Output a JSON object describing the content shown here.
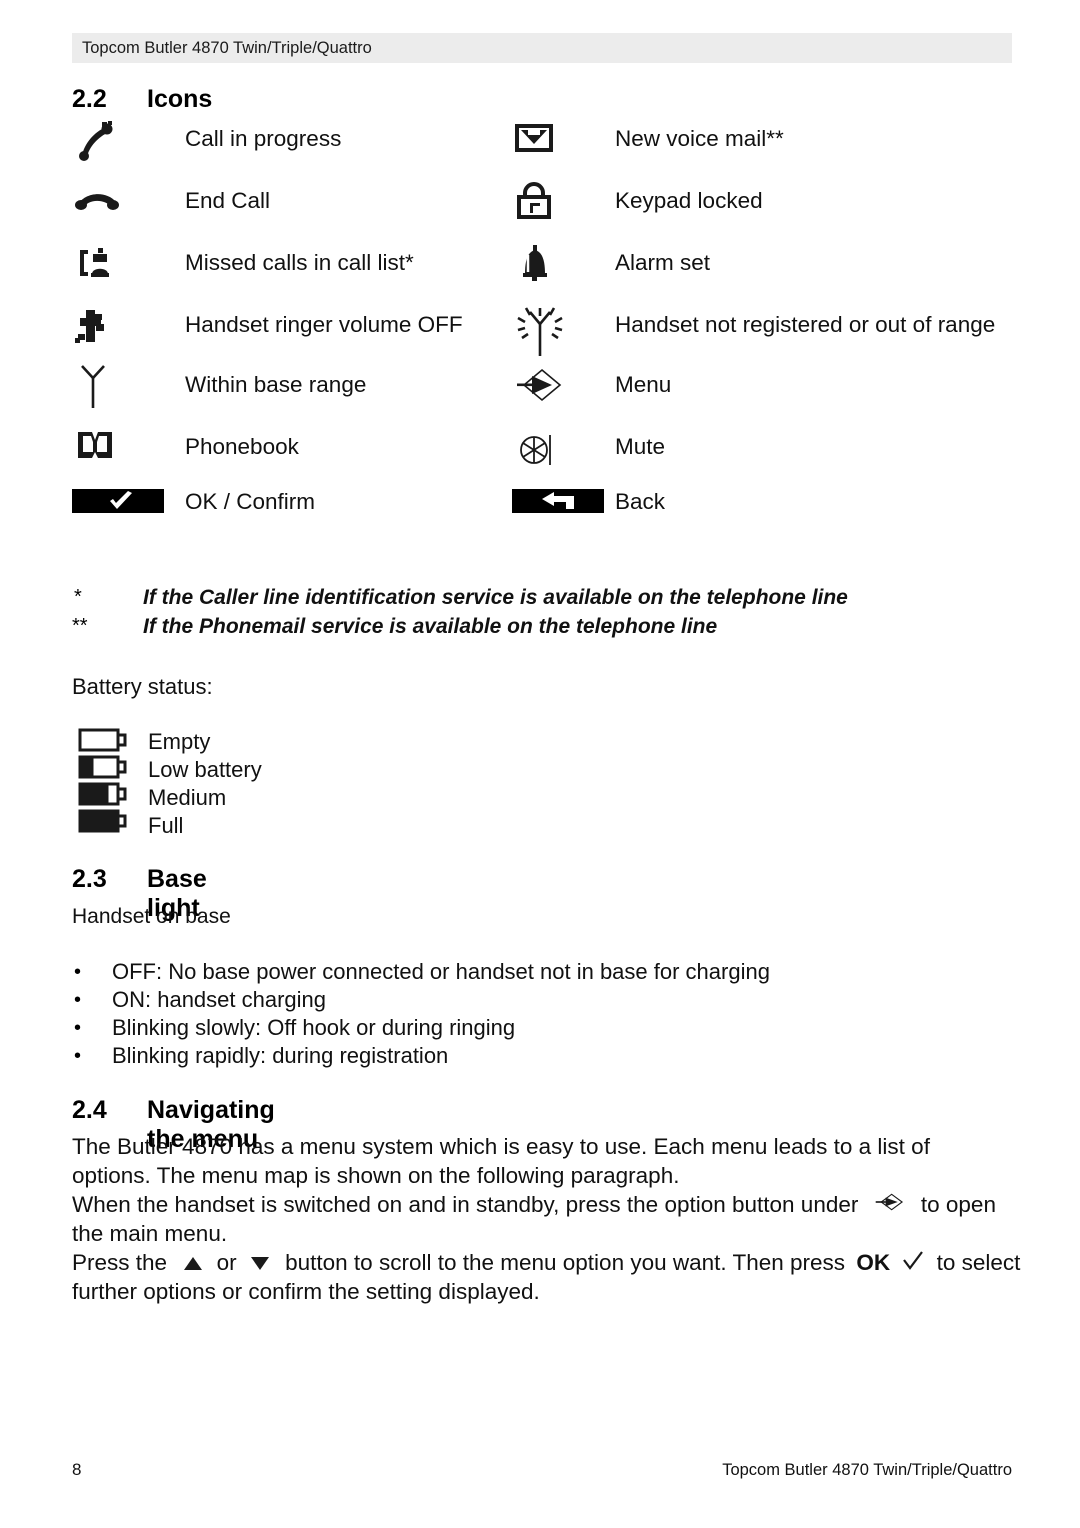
{
  "header": {
    "title": "Topcom Butler 4870 Twin/Triple/Quattro"
  },
  "sections": {
    "icons": {
      "number": "2.2",
      "title": "Icons",
      "rows": [
        {
          "left_icon": "phone-off-hook-icon",
          "left_label": "Call in progress",
          "right_icon": "envelope-voicemail-icon",
          "right_label": "New voice mail**"
        },
        {
          "left_icon": "phone-on-hook-icon",
          "left_label": "End Call",
          "right_icon": "padlock-icon",
          "right_label": "Keypad locked"
        },
        {
          "left_icon": "missed-calls-icon",
          "left_label": "Missed calls in call list*",
          "right_icon": "alarm-bell-icon",
          "right_label": "Alarm set"
        },
        {
          "left_icon": "ringer-off-icon",
          "left_label": "Handset ringer volume OFF",
          "right_icon": "antenna-blinking-icon",
          "right_label": "Handset not registered or out of range"
        },
        {
          "left_icon": "antenna-icon",
          "left_label": "Within base range",
          "right_icon": "menu-arrow-icon",
          "right_label": "Menu"
        },
        {
          "left_icon": "phonebook-icon",
          "left_label": "Phonebook",
          "right_icon": "mute-icon",
          "right_label": "Mute"
        },
        {
          "left_icon": "softkey-check-icon",
          "left_label": "OK / Confirm",
          "right_icon": "softkey-back-icon",
          "right_label": "Back"
        }
      ],
      "footnotes": [
        {
          "mark": "*",
          "text": "If the Caller line identification service is available on the telephone line"
        },
        {
          "mark": "**",
          "text": "If the Phonemail service is available on the telephone line"
        }
      ],
      "battery": {
        "heading": "Battery status:",
        "levels": [
          {
            "icon": "battery-empty-icon",
            "label": "Empty",
            "fill": 0
          },
          {
            "icon": "battery-low-icon",
            "label": "Low battery",
            "fill": 33
          },
          {
            "icon": "battery-medium-icon",
            "label": "Medium",
            "fill": 72
          },
          {
            "icon": "battery-full-icon",
            "label": "Full",
            "fill": 100
          }
        ]
      }
    },
    "base_light": {
      "number": "2.3",
      "title": "Base light",
      "intro": "Handset on base",
      "bullets": [
        "OFF: No base power connected or handset not in base for charging",
        "ON: handset charging",
        "Blinking slowly: Off hook or during ringing",
        "Blinking rapidly: during registration"
      ]
    },
    "navigating": {
      "number": "2.4",
      "title": "Navigating the menu",
      "lines": [
        "The Butler 4870 has a menu system which is easy to use. Each menu leads to a list of",
        "options. The menu map is shown on the following paragraph.",
        "the main menu.",
        "further options or confirm the setting displayed."
      ],
      "line3_a": "When the handset is switched on and in standby, press the option button under",
      "line3_b": "to open",
      "line5_a": "Press the",
      "line5_or": "or",
      "line5_b": "button to scroll to the menu option you want. Then press",
      "line5_ok": "OK",
      "line5_c": "to select",
      "inline_icons": {
        "menu": "menu-arrow-icon",
        "up": "triangle-up-icon",
        "down": "triangle-down-icon",
        "check": "checkmark-icon"
      }
    }
  },
  "footer": {
    "page_number": "8",
    "title": "Topcom Butler 4870 Twin/Triple/Quattro"
  },
  "colors": {
    "header_band": "#ececec",
    "text": "#111111",
    "ink": "#1a1a1a"
  }
}
